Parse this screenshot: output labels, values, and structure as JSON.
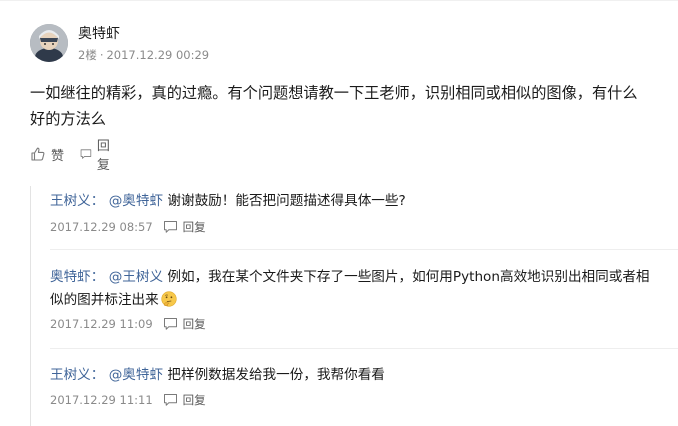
{
  "comment": {
    "author": "奥特虾",
    "floor": "2楼",
    "separator": "·",
    "time": "2017.12.29 00:29",
    "text": "一如继往的精彩，真的过瘾。有个问题想请教一下王老师，识别相同或相似的图像，有什么好的方法么",
    "like_label": "赞",
    "reply_label": "回复"
  },
  "replies": [
    {
      "author": "王树义：",
      "mention": "@奥特虾",
      "text": " 谢谢鼓励！能否把问题描述得具体一些?",
      "time": "2017.12.29 08:57",
      "reply_label": "回复"
    },
    {
      "author": "奥特虾：",
      "mention": "@王树义",
      "text": " 例如，我在某个文件夹下存了一些图片，如何用Python高效地识别出相同或者相似的图并标注出来",
      "emoji": "thinking-face-icon",
      "time": "2017.12.29 11:09",
      "reply_label": "回复"
    },
    {
      "author": "王树义：",
      "mention": "@奥特虾",
      "text": " 把样例数据发给我一份，我帮你看看",
      "time": "2017.12.29 11:11",
      "reply_label": "回复"
    }
  ],
  "colors": {
    "link": "#406599",
    "meta": "#8a8a8a",
    "text": "#1a1a1a"
  }
}
